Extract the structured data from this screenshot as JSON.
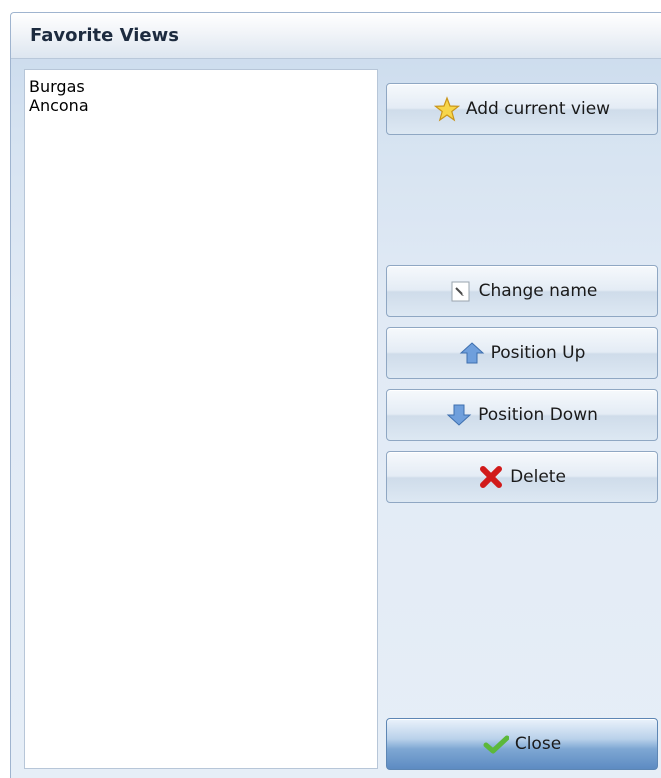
{
  "window": {
    "title": "Favorite Views"
  },
  "views_list": {
    "items": [
      "Burgas",
      "Ancona"
    ]
  },
  "buttons": {
    "add_current_view": "Add current view",
    "change_name": "Change name",
    "position_up": "Position Up",
    "position_down": "Position Down",
    "delete": "Delete",
    "close": "Close"
  },
  "icons": {
    "add": "star-icon",
    "rename": "pencil-note-icon",
    "up": "arrow-up-icon",
    "down": "arrow-down-icon",
    "delete": "red-x-icon",
    "close": "green-check-icon"
  },
  "colors": {
    "accent": "#5d8bc2",
    "delete": "#d11a1a",
    "check": "#5cb83a",
    "star": "#f4c430"
  }
}
